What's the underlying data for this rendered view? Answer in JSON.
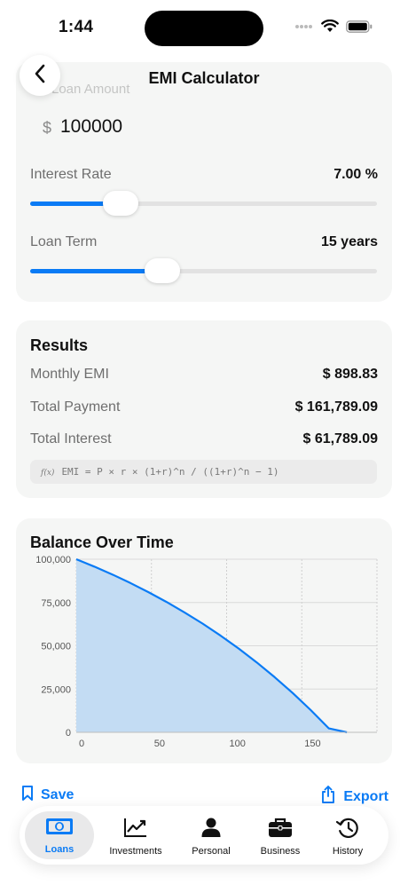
{
  "status": {
    "time": "1:44"
  },
  "nav": {
    "title": "EMI Calculator"
  },
  "loan_amount": {
    "label": "Loan Amount",
    "currency": "$",
    "value": "100000"
  },
  "interest_rate": {
    "label": "Interest Rate",
    "value": "7.00 %",
    "slider_fraction": 0.26
  },
  "loan_term": {
    "label": "Loan Term",
    "value": "15 years",
    "slider_fraction": 0.38
  },
  "results": {
    "title": "Results",
    "monthly_emi_label": "Monthly EMI",
    "monthly_emi": "$ 898.83",
    "total_payment_label": "Total Payment",
    "total_payment": "$ 161,789.09",
    "total_interest_label": "Total Interest",
    "total_interest": "$ 61,789.09",
    "formula_icon": "f(x)",
    "formula": "EMI = P × r × (1+r)^n / ((1+r)^n − 1)"
  },
  "chart_data": {
    "type": "area",
    "title": "Balance Over Time",
    "xlabel": "",
    "ylabel": "",
    "x_ticks": [
      "0",
      "50",
      "100",
      "150"
    ],
    "y_ticks": [
      "0",
      "25,000",
      "50,000",
      "75,000",
      "100,000"
    ],
    "xlim": [
      0,
      200
    ],
    "ylim": [
      0,
      100000
    ],
    "grid": true,
    "series": [
      {
        "x": [
          0,
          12,
          24,
          36,
          48,
          60,
          72,
          84,
          96,
          108,
          120,
          132,
          144,
          156,
          168,
          180
        ],
        "values": [
          100000,
          95732,
          91156,
          86250,
          80990,
          75350,
          69302,
          62817,
          55864,
          48409,
          40415,
          31843,
          22653,
          12799,
          2233,
          0
        ]
      }
    ],
    "colors": {
      "line": "#0a7bf5",
      "fill": "#c3dcf3"
    }
  },
  "actions": {
    "save": "Save",
    "export": "Export"
  },
  "tabs": [
    {
      "label": "Loans",
      "icon": "banknote-icon",
      "active": true
    },
    {
      "label": "Investments",
      "icon": "chart-line-icon",
      "active": false
    },
    {
      "label": "Personal",
      "icon": "person-icon",
      "active": false
    },
    {
      "label": "Business",
      "icon": "briefcase-icon",
      "active": false
    },
    {
      "label": "History",
      "icon": "history-icon",
      "active": false
    }
  ],
  "colors": {
    "accent": "#0a7bf5",
    "card": "#f5f6f5"
  }
}
